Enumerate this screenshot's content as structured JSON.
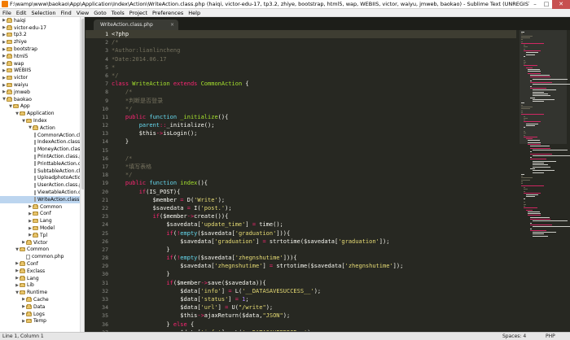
{
  "window": {
    "title": "F:\\wamp\\www\\baokao\\App\\Application\\Index\\Action\\WriteAction.class.php (haiqi, victor-edu-17, tp3.2, zhiye, bootstrap, html5, wap, WEBIIS, victor, waiyu, jmweb, baokao) - Sublime Text (UNREGISTERED)"
  },
  "menu": [
    "File",
    "Edit",
    "Selection",
    "Find",
    "View",
    "Goto",
    "Tools",
    "Project",
    "Preferences",
    "Help"
  ],
  "sidebar": {
    "items": [
      {
        "label": "haiqi",
        "depth": 0,
        "kind": "folder",
        "open": false
      },
      {
        "label": "victor-edu-17",
        "depth": 0,
        "kind": "folder",
        "open": false
      },
      {
        "label": "tp3.2",
        "depth": 0,
        "kind": "folder",
        "open": false
      },
      {
        "label": "zhiye",
        "depth": 0,
        "kind": "folder",
        "open": false
      },
      {
        "label": "bootstrap",
        "depth": 0,
        "kind": "folder",
        "open": false
      },
      {
        "label": "html5",
        "depth": 0,
        "kind": "folder",
        "open": false
      },
      {
        "label": "wap",
        "depth": 0,
        "kind": "folder",
        "open": false
      },
      {
        "label": "WEBIIS",
        "depth": 0,
        "kind": "folder",
        "open": false
      },
      {
        "label": "victor",
        "depth": 0,
        "kind": "folder",
        "open": false
      },
      {
        "label": "waiyu",
        "depth": 0,
        "kind": "folder",
        "open": false
      },
      {
        "label": "jmweb",
        "depth": 0,
        "kind": "folder",
        "open": false
      },
      {
        "label": "baokao",
        "depth": 0,
        "kind": "folder",
        "open": true
      },
      {
        "label": "App",
        "depth": 1,
        "kind": "folder",
        "open": true
      },
      {
        "label": "Application",
        "depth": 2,
        "kind": "folder",
        "open": true
      },
      {
        "label": "Index",
        "depth": 3,
        "kind": "folder",
        "open": true
      },
      {
        "label": "Action",
        "depth": 4,
        "kind": "folder",
        "open": true
      },
      {
        "label": "CommonAction.class.php",
        "depth": 5,
        "kind": "file"
      },
      {
        "label": "IndexAction.class.php",
        "depth": 5,
        "kind": "file"
      },
      {
        "label": "MoneyAction.class.php",
        "depth": 5,
        "kind": "file"
      },
      {
        "label": "PrintAction.class.php",
        "depth": 5,
        "kind": "file"
      },
      {
        "label": "PrinttableAction.class.php",
        "depth": 5,
        "kind": "file"
      },
      {
        "label": "SubtableAction.class.php",
        "depth": 5,
        "kind": "file"
      },
      {
        "label": "UploadphotoAction.class.php",
        "depth": 5,
        "kind": "file"
      },
      {
        "label": "UserAction.class.php",
        "depth": 5,
        "kind": "file"
      },
      {
        "label": "ViewtableAction.class.php",
        "depth": 5,
        "kind": "file"
      },
      {
        "label": "WriteAction.class.php",
        "depth": 5,
        "kind": "file",
        "selected": true
      },
      {
        "label": "Common",
        "depth": 4,
        "kind": "folder",
        "open": false
      },
      {
        "label": "Conf",
        "depth": 4,
        "kind": "folder",
        "open": false
      },
      {
        "label": "Lang",
        "depth": 4,
        "kind": "folder",
        "open": false
      },
      {
        "label": "Model",
        "depth": 4,
        "kind": "folder",
        "open": false
      },
      {
        "label": "Tpl",
        "depth": 4,
        "kind": "folder",
        "open": false
      },
      {
        "label": "Victor",
        "depth": 3,
        "kind": "folder",
        "open": false
      },
      {
        "label": "Common",
        "depth": 2,
        "kind": "folder",
        "open": true
      },
      {
        "label": "common.php",
        "depth": 3,
        "kind": "file"
      },
      {
        "label": "Conf",
        "depth": 2,
        "kind": "folder",
        "open": false
      },
      {
        "label": "Exclass",
        "depth": 2,
        "kind": "folder",
        "open": false
      },
      {
        "label": "Lang",
        "depth": 2,
        "kind": "folder",
        "open": false
      },
      {
        "label": "Lib",
        "depth": 2,
        "kind": "folder",
        "open": false
      },
      {
        "label": "Runtime",
        "depth": 2,
        "kind": "folder",
        "open": true
      },
      {
        "label": "Cache",
        "depth": 3,
        "kind": "folder",
        "open": false
      },
      {
        "label": "Data",
        "depth": 3,
        "kind": "folder",
        "open": false
      },
      {
        "label": "Logs",
        "depth": 3,
        "kind": "folder",
        "open": false
      },
      {
        "label": "Temp",
        "depth": 3,
        "kind": "folder",
        "open": false
      }
    ]
  },
  "tabs": [
    {
      "label": "WriteAction.class.php",
      "close": "×"
    }
  ],
  "editor": {
    "current_line": 1,
    "line_numbers": [
      1,
      2,
      3,
      4,
      5,
      6,
      7,
      8,
      9,
      10,
      11,
      12,
      13,
      14,
      15,
      16,
      17,
      18,
      19,
      20,
      21,
      22,
      23,
      24,
      25,
      26,
      27,
      28,
      29,
      30,
      31,
      32,
      33,
      34,
      35,
      36,
      37,
      38
    ],
    "lines": [
      [
        [
          "<?php",
          "fg"
        ]
      ],
      [
        [
          "/*",
          "cm"
        ]
      ],
      [
        [
          "*Author:lianlincheng",
          "cm"
        ]
      ],
      [
        [
          "*Date:2014.06.17",
          "cm"
        ]
      ],
      [
        [
          "*",
          "cm"
        ]
      ],
      [
        [
          "*/",
          "cm"
        ]
      ],
      [
        [
          "class ",
          "kw"
        ],
        [
          "WriteAction ",
          "cls"
        ],
        [
          "extends ",
          "kw"
        ],
        [
          "CommonAction ",
          "cls"
        ],
        [
          "{",
          "fg"
        ]
      ],
      [
        [
          "    /*",
          "cm"
        ]
      ],
      [
        [
          "    *判断是否登录",
          "cm"
        ]
      ],
      [
        [
          "    */",
          "cm"
        ]
      ],
      [
        [
          "    public ",
          "kw"
        ],
        [
          "function ",
          "st"
        ],
        [
          "_initialize",
          "fn"
        ],
        [
          "(){",
          "fg"
        ]
      ],
      [
        [
          "        ",
          "fg"
        ],
        [
          "parent",
          "st"
        ],
        [
          "::",
          "kw"
        ],
        [
          "_initialize();",
          "fg"
        ]
      ],
      [
        [
          "        $this",
          "fg"
        ],
        [
          "->",
          "kw"
        ],
        [
          "isLogin();",
          "fg"
        ]
      ],
      [
        [
          "    }",
          "fg"
        ]
      ],
      [
        [
          "",
          "fg"
        ]
      ],
      [
        [
          "    /*",
          "cm"
        ]
      ],
      [
        [
          "    *填写表格",
          "cm"
        ]
      ],
      [
        [
          "    */",
          "cm"
        ]
      ],
      [
        [
          "    public ",
          "kw"
        ],
        [
          "function ",
          "st"
        ],
        [
          "index",
          "fn"
        ],
        [
          "(){",
          "fg"
        ]
      ],
      [
        [
          "        if",
          "kw"
        ],
        [
          "(IS_POST){",
          "fg"
        ]
      ],
      [
        [
          "            $member ",
          "fg"
        ],
        [
          "= ",
          "kw"
        ],
        [
          "D(",
          "fg"
        ],
        [
          "'Write'",
          "str"
        ],
        [
          ");",
          "fg"
        ]
      ],
      [
        [
          "            $savedata ",
          "fg"
        ],
        [
          "= ",
          "kw"
        ],
        [
          "I(",
          "fg"
        ],
        [
          "'post.'",
          "str"
        ],
        [
          ");",
          "fg"
        ]
      ],
      [
        [
          "            if",
          "kw"
        ],
        [
          "($member",
          "fg"
        ],
        [
          "->",
          "kw"
        ],
        [
          "create()){",
          "fg"
        ]
      ],
      [
        [
          "                $savedata[",
          "fg"
        ],
        [
          "'update_time'",
          "str"
        ],
        [
          "] ",
          "fg"
        ],
        [
          "= ",
          "kw"
        ],
        [
          "time();",
          "fg"
        ]
      ],
      [
        [
          "                if",
          "kw"
        ],
        [
          "(",
          "fg"
        ],
        [
          "!",
          "kw"
        ],
        [
          "empty",
          "st"
        ],
        [
          "($savedata[",
          "fg"
        ],
        [
          "'graduation'",
          "str"
        ],
        [
          "])){",
          "fg"
        ]
      ],
      [
        [
          "                    $savedata[",
          "fg"
        ],
        [
          "'graduation'",
          "str"
        ],
        [
          "] ",
          "fg"
        ],
        [
          "= ",
          "kw"
        ],
        [
          "strtotime($savedata[",
          "fg"
        ],
        [
          "'graduation'",
          "str"
        ],
        [
          "]);",
          "fg"
        ]
      ],
      [
        [
          "                }",
          "fg"
        ]
      ],
      [
        [
          "                if",
          "kw"
        ],
        [
          "(",
          "fg"
        ],
        [
          "!",
          "kw"
        ],
        [
          "empty",
          "st"
        ],
        [
          "($savedata[",
          "fg"
        ],
        [
          "'zhegnshutime'",
          "str"
        ],
        [
          "])){",
          "fg"
        ]
      ],
      [
        [
          "                    $savedata[",
          "fg"
        ],
        [
          "'zhegnshutime'",
          "str"
        ],
        [
          "] ",
          "fg"
        ],
        [
          "= ",
          "kw"
        ],
        [
          "strtotime($savedata[",
          "fg"
        ],
        [
          "'zhegnshutime'",
          "str"
        ],
        [
          "]);",
          "fg"
        ]
      ],
      [
        [
          "                }",
          "fg"
        ]
      ],
      [
        [
          "                if",
          "kw"
        ],
        [
          "($member",
          "fg"
        ],
        [
          "->",
          "kw"
        ],
        [
          "save($savedata)){",
          "fg"
        ]
      ],
      [
        [
          "                    $data[",
          "fg"
        ],
        [
          "'info'",
          "str"
        ],
        [
          "] ",
          "fg"
        ],
        [
          "= ",
          "kw"
        ],
        [
          "L(",
          "fg"
        ],
        [
          "'__DATASAVESUCCESS__'",
          "str"
        ],
        [
          ");",
          "fg"
        ]
      ],
      [
        [
          "                    $data[",
          "fg"
        ],
        [
          "'status'",
          "str"
        ],
        [
          "] ",
          "fg"
        ],
        [
          "= ",
          "kw"
        ],
        [
          "1",
          "num"
        ],
        [
          ";",
          "fg"
        ]
      ],
      [
        [
          "                    $data[",
          "fg"
        ],
        [
          "'url'",
          "str"
        ],
        [
          "] ",
          "fg"
        ],
        [
          "= ",
          "kw"
        ],
        [
          "U(",
          "fg"
        ],
        [
          "\"/write\"",
          "str"
        ],
        [
          ");",
          "fg"
        ]
      ],
      [
        [
          "                    $this",
          "fg"
        ],
        [
          "->",
          "kw"
        ],
        [
          "ajaxReturn($data,",
          "fg"
        ],
        [
          "\"JSON\"",
          "str"
        ],
        [
          ");",
          "fg"
        ]
      ],
      [
        [
          "                } ",
          "fg"
        ],
        [
          "else ",
          "kw"
        ],
        [
          "{",
          "fg"
        ]
      ],
      [
        [
          "                    $data[",
          "fg"
        ],
        [
          "'info'",
          "str"
        ],
        [
          "] ",
          "fg"
        ],
        [
          "= ",
          "kw"
        ],
        [
          "L(",
          "fg"
        ],
        [
          "'__DATASAVEERROR__'",
          "str"
        ],
        [
          ");",
          "fg"
        ]
      ],
      [
        [
          "                    $data[",
          "fg"
        ],
        [
          "'status'",
          "str"
        ],
        [
          "] ",
          "fg"
        ],
        [
          "= ",
          "kw"
        ],
        [
          "0",
          "num"
        ],
        [
          ";",
          "fg"
        ]
      ]
    ]
  },
  "syntax_colors": {
    "fg": "#f8f8f2",
    "cm": "#75715e",
    "kw": "#f92672",
    "st": "#66d9ef",
    "cls": "#a6e22e",
    "fn": "#a6e22e",
    "str": "#e6db74",
    "num": "#ae81ff"
  },
  "status": {
    "position": "Line 1, Column 1",
    "spaces": "Spaces: 4",
    "syntax": "PHP"
  }
}
